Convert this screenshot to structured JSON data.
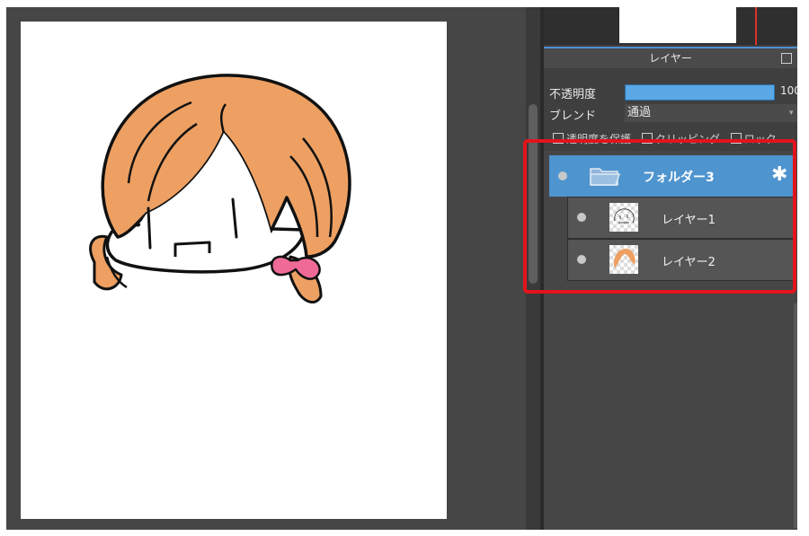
{
  "layers_panel": {
    "title": "レイヤー",
    "opacity_label": "不透明度",
    "opacity_value": "100",
    "opacity_fraction": 1.0,
    "blend_label": "ブレンド",
    "blend_value": "通過",
    "options": [
      "透明度を保護",
      "クリッピング",
      "ロック"
    ]
  },
  "layers": {
    "folder": {
      "name": "フォルダー3",
      "icon": "folder-icon",
      "settings_icon": "gear-icon"
    },
    "items": [
      {
        "name": "レイヤー1",
        "thumbnail": "line-art-thumbnail"
      },
      {
        "name": "レイヤー2",
        "thumbnail": "hair-color-thumbnail"
      }
    ]
  },
  "colors": {
    "selected_folder": "#4e94cf",
    "highlight_border": "#e3141b",
    "hair": "#eda062",
    "ribbon": "#f06a97"
  }
}
